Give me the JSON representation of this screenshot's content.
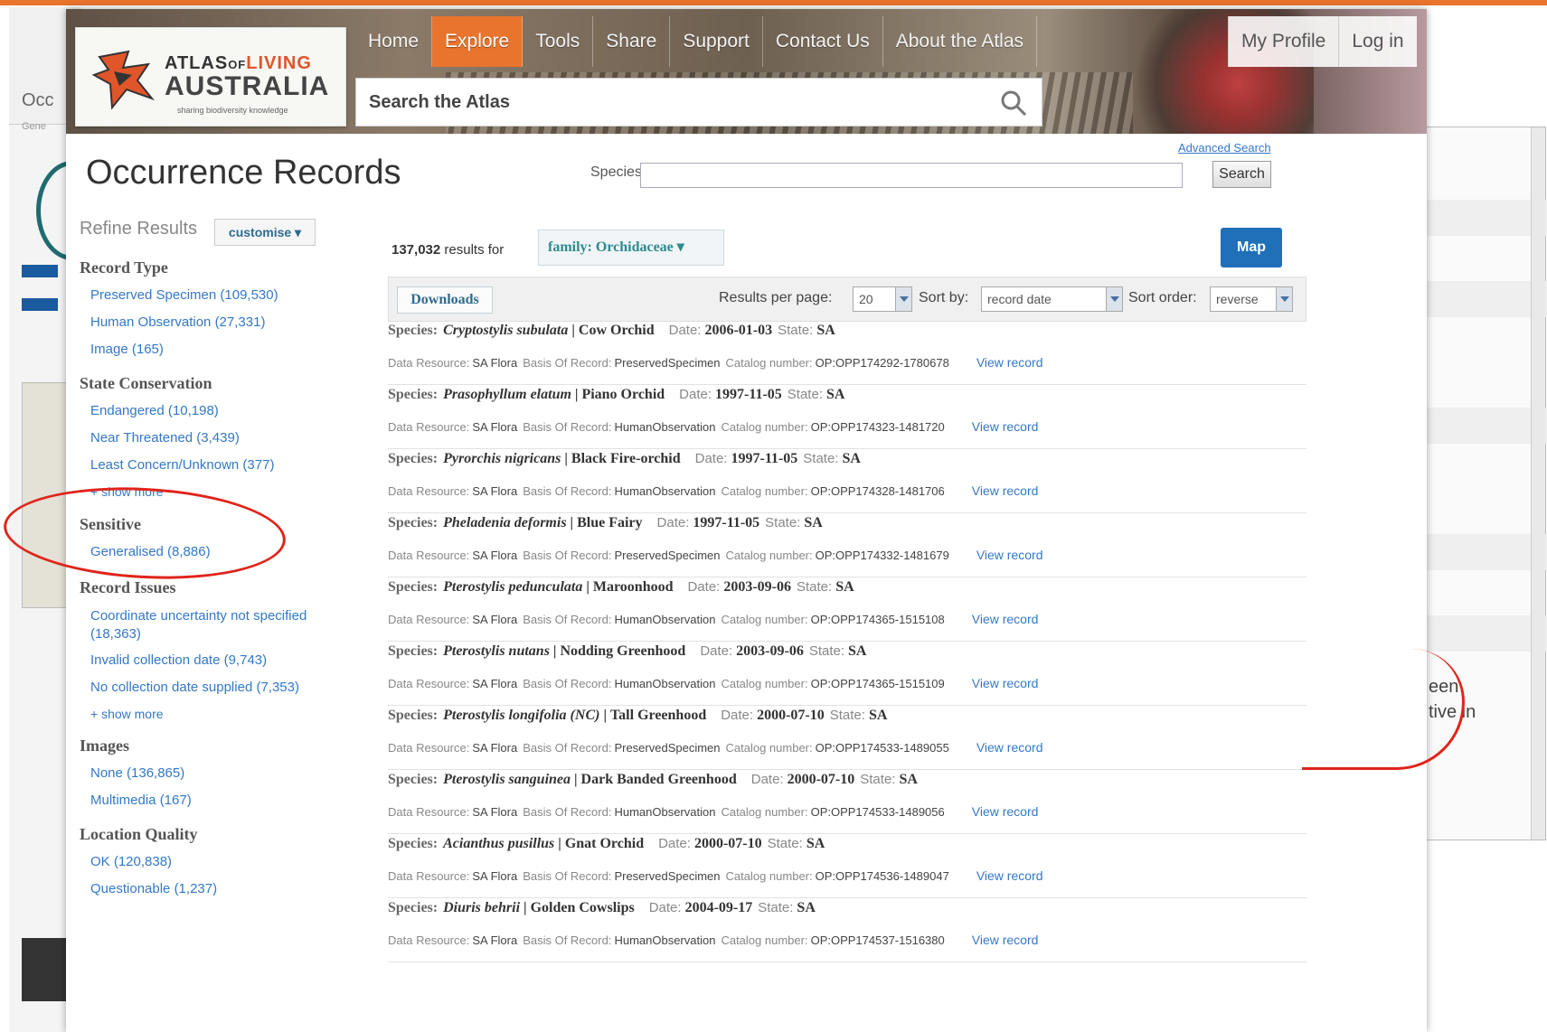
{
  "nav": {
    "items": [
      "Home",
      "Explore",
      "Tools",
      "Share",
      "Support",
      "Contact Us",
      "About the Atlas"
    ],
    "right_items": [
      "My Profile",
      "Log in"
    ]
  },
  "logo": {
    "line1_a": "ATLAS",
    "line1_b": "OF",
    "line1_c": "LIVING",
    "line2": "AUSTRALIA",
    "tagline": "sharing biodiversity knowledge"
  },
  "search": {
    "placeholder": "Search the Atlas",
    "advanced_label": "Advanced Search",
    "species_label": "Species",
    "button_label": "Search"
  },
  "page": {
    "title": "Occurrence Records"
  },
  "sidebar": {
    "refine_label": "Refine Results",
    "customise_label": "customise ▾",
    "groups": [
      {
        "title": "Record Type",
        "items": [
          "Preserved Specimen (109,530)",
          "Human Observation (27,331)",
          "Image (165)"
        ]
      },
      {
        "title": "State Conservation",
        "items": [
          "Endangered (10,198)",
          "Near Threatened (3,439)",
          "Least Concern/Unknown (377)"
        ],
        "more": "+ show more"
      },
      {
        "title": "Sensitive",
        "items": [
          "Generalised (8,886)"
        ]
      },
      {
        "title": "Record Issues",
        "items": [
          "Coordinate uncertainty not specified (18,363)",
          "Invalid collection date (9,743)",
          "No collection date supplied (7,353)"
        ],
        "more": "+ show more"
      },
      {
        "title": "Images",
        "items": [
          "None (136,865)",
          "Multimedia (167)"
        ]
      },
      {
        "title": "Location Quality",
        "items": [
          "OK (120,838)",
          "Questionable (1,237)"
        ]
      }
    ]
  },
  "results": {
    "count": "137,032",
    "count_suffix": "results for",
    "filter_chip": "family: Orchidaceae ▾",
    "map_label": "Map",
    "downloads_label": "Downloads",
    "per_page_label": "Results per page:",
    "per_page_value": "20",
    "sort_by_label": "Sort by:",
    "sort_by_value": "record date",
    "sort_order_label": "Sort order:",
    "sort_order_value": "reverse",
    "labels": {
      "species": "Species:",
      "date": "Date:",
      "state": "State:",
      "data_resource": "Data Resource:",
      "basis": "Basis Of Record:",
      "catalog": "Catalog number:",
      "view": "View record"
    },
    "records": [
      {
        "sci": "Cryptostylis subulata",
        "common": "Cow Orchid",
        "date": "2006-01-03",
        "state": "SA",
        "resource": "SA Flora",
        "basis": "PreservedSpecimen",
        "catalog": "OP:OPP174292-1780678"
      },
      {
        "sci": "Prasophyllum elatum",
        "common": "Piano Orchid",
        "date": "1997-11-05",
        "state": "SA",
        "resource": "SA Flora",
        "basis": "HumanObservation",
        "catalog": "OP:OPP174323-1481720"
      },
      {
        "sci": "Pyrorchis nigricans",
        "common": "Black Fire-orchid",
        "date": "1997-11-05",
        "state": "SA",
        "resource": "SA Flora",
        "basis": "HumanObservation",
        "catalog": "OP:OPP174328-1481706"
      },
      {
        "sci": "Pheladenia deformis",
        "common": "Blue Fairy",
        "date": "1997-11-05",
        "state": "SA",
        "resource": "SA Flora",
        "basis": "PreservedSpecimen",
        "catalog": "OP:OPP174332-1481679"
      },
      {
        "sci": "Pterostylis pedunculata",
        "common": "Maroonhood",
        "date": "2003-09-06",
        "state": "SA",
        "resource": "SA Flora",
        "basis": "HumanObservation",
        "catalog": "OP:OPP174365-1515108"
      },
      {
        "sci": "Pterostylis nutans",
        "common": "Nodding Greenhood",
        "date": "2003-09-06",
        "state": "SA",
        "resource": "SA Flora",
        "basis": "HumanObservation",
        "catalog": "OP:OPP174365-1515109"
      },
      {
        "sci": "Pterostylis longifolia (NC)",
        "common": "Tall Greenhood",
        "date": "2000-07-10",
        "state": "SA",
        "resource": "SA Flora",
        "basis": "PreservedSpecimen",
        "catalog": "OP:OPP174533-1489055"
      },
      {
        "sci": "Pterostylis sanguinea",
        "common": "Dark Banded Greenhood",
        "date": "2000-07-10",
        "state": "SA",
        "resource": "SA Flora",
        "basis": "HumanObservation",
        "catalog": "OP:OPP174533-1489056"
      },
      {
        "sci": "Acianthus pusillus",
        "common": "Gnat Orchid",
        "date": "2000-07-10",
        "state": "SA",
        "resource": "SA Flora",
        "basis": "PreservedSpecimen",
        "catalog": "OP:OPP174536-1489047"
      },
      {
        "sci": "Diuris behrii",
        "common": "Golden Cowslips",
        "date": "2004-09-17",
        "state": "SA",
        "resource": "SA Flora",
        "basis": "HumanObservation",
        "catalog": "OP:OPP174537-1516380"
      }
    ]
  },
  "background": {
    "left_title": "Occ",
    "left_sub": "Gene",
    "right_text_1": "een",
    "right_text_2": "tive in"
  },
  "colors": {
    "accent": "#e8742e",
    "link": "#3478c7",
    "map_button": "#1f6fb9",
    "annotation": "#e0241a"
  }
}
